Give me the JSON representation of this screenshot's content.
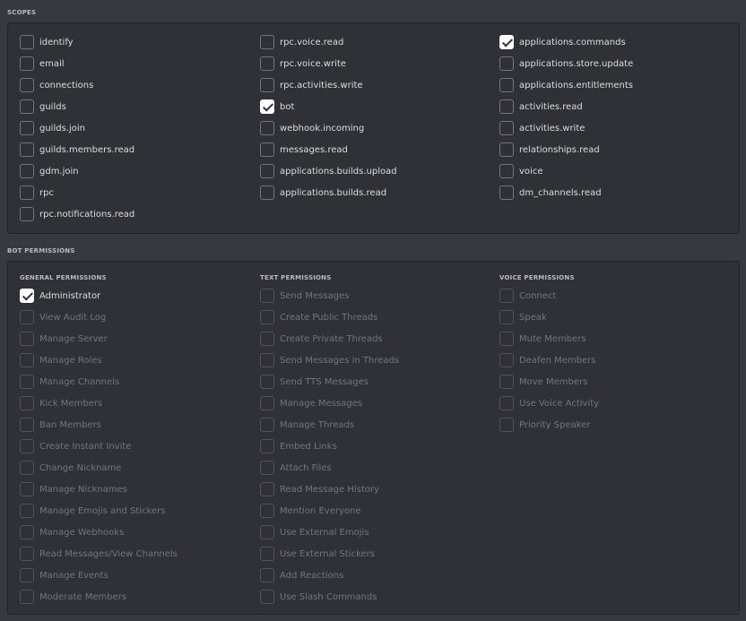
{
  "scopes": {
    "title": "SCOPES",
    "columns": [
      [
        {
          "label": "identify",
          "checked": false
        },
        {
          "label": "email",
          "checked": false
        },
        {
          "label": "connections",
          "checked": false
        },
        {
          "label": "guilds",
          "checked": false
        },
        {
          "label": "guilds.join",
          "checked": false
        },
        {
          "label": "guilds.members.read",
          "checked": false
        },
        {
          "label": "gdm.join",
          "checked": false
        },
        {
          "label": "rpc",
          "checked": false
        },
        {
          "label": "rpc.notifications.read",
          "checked": false
        }
      ],
      [
        {
          "label": "rpc.voice.read",
          "checked": false
        },
        {
          "label": "rpc.voice.write",
          "checked": false
        },
        {
          "label": "rpc.activities.write",
          "checked": false
        },
        {
          "label": "bot",
          "checked": true
        },
        {
          "label": "webhook.incoming",
          "checked": false
        },
        {
          "label": "messages.read",
          "checked": false
        },
        {
          "label": "applications.builds.upload",
          "checked": false
        },
        {
          "label": "applications.builds.read",
          "checked": false
        }
      ],
      [
        {
          "label": "applications.commands",
          "checked": true
        },
        {
          "label": "applications.store.update",
          "checked": false
        },
        {
          "label": "applications.entitlements",
          "checked": false
        },
        {
          "label": "activities.read",
          "checked": false
        },
        {
          "label": "activities.write",
          "checked": false
        },
        {
          "label": "relationships.read",
          "checked": false
        },
        {
          "label": "voice",
          "checked": false
        },
        {
          "label": "dm_channels.read",
          "checked": false
        }
      ]
    ]
  },
  "bot_permissions": {
    "title": "BOT PERMISSIONS",
    "groups": [
      {
        "title": "GENERAL PERMISSIONS",
        "items": [
          {
            "label": "Administrator",
            "checked": true,
            "disabled": false
          },
          {
            "label": "View Audit Log",
            "checked": false,
            "disabled": true
          },
          {
            "label": "Manage Server",
            "checked": false,
            "disabled": true
          },
          {
            "label": "Manage Roles",
            "checked": false,
            "disabled": true
          },
          {
            "label": "Manage Channels",
            "checked": false,
            "disabled": true
          },
          {
            "label": "Kick Members",
            "checked": false,
            "disabled": true
          },
          {
            "label": "Ban Members",
            "checked": false,
            "disabled": true
          },
          {
            "label": "Create Instant Invite",
            "checked": false,
            "disabled": true
          },
          {
            "label": "Change Nickname",
            "checked": false,
            "disabled": true
          },
          {
            "label": "Manage Nicknames",
            "checked": false,
            "disabled": true
          },
          {
            "label": "Manage Emojis and Stickers",
            "checked": false,
            "disabled": true
          },
          {
            "label": "Manage Webhooks",
            "checked": false,
            "disabled": true
          },
          {
            "label": "Read Messages/View Channels",
            "checked": false,
            "disabled": true
          },
          {
            "label": "Manage Events",
            "checked": false,
            "disabled": true
          },
          {
            "label": "Moderate Members",
            "checked": false,
            "disabled": true
          }
        ]
      },
      {
        "title": "TEXT PERMISSIONS",
        "items": [
          {
            "label": "Send Messages",
            "checked": false,
            "disabled": true
          },
          {
            "label": "Create Public Threads",
            "checked": false,
            "disabled": true
          },
          {
            "label": "Create Private Threads",
            "checked": false,
            "disabled": true
          },
          {
            "label": "Send Messages in Threads",
            "checked": false,
            "disabled": true
          },
          {
            "label": "Send TTS Messages",
            "checked": false,
            "disabled": true
          },
          {
            "label": "Manage Messages",
            "checked": false,
            "disabled": true
          },
          {
            "label": "Manage Threads",
            "checked": false,
            "disabled": true
          },
          {
            "label": "Embed Links",
            "checked": false,
            "disabled": true
          },
          {
            "label": "Attach Files",
            "checked": false,
            "disabled": true
          },
          {
            "label": "Read Message History",
            "checked": false,
            "disabled": true
          },
          {
            "label": "Mention Everyone",
            "checked": false,
            "disabled": true
          },
          {
            "label": "Use External Emojis",
            "checked": false,
            "disabled": true
          },
          {
            "label": "Use External Stickers",
            "checked": false,
            "disabled": true
          },
          {
            "label": "Add Reactions",
            "checked": false,
            "disabled": true
          },
          {
            "label": "Use Slash Commands",
            "checked": false,
            "disabled": true
          }
        ]
      },
      {
        "title": "VOICE PERMISSIONS",
        "items": [
          {
            "label": "Connect",
            "checked": false,
            "disabled": true
          },
          {
            "label": "Speak",
            "checked": false,
            "disabled": true
          },
          {
            "label": "Mute Members",
            "checked": false,
            "disabled": true
          },
          {
            "label": "Deafen Members",
            "checked": false,
            "disabled": true
          },
          {
            "label": "Move Members",
            "checked": false,
            "disabled": true
          },
          {
            "label": "Use Voice Activity",
            "checked": false,
            "disabled": true
          },
          {
            "label": "Priority Speaker",
            "checked": false,
            "disabled": true
          }
        ]
      }
    ]
  },
  "colors": {
    "background": "#36393f",
    "panel": "#2f3136",
    "text": "#dcddde",
    "muted_text": "#72767d",
    "check": "#ffffff"
  }
}
